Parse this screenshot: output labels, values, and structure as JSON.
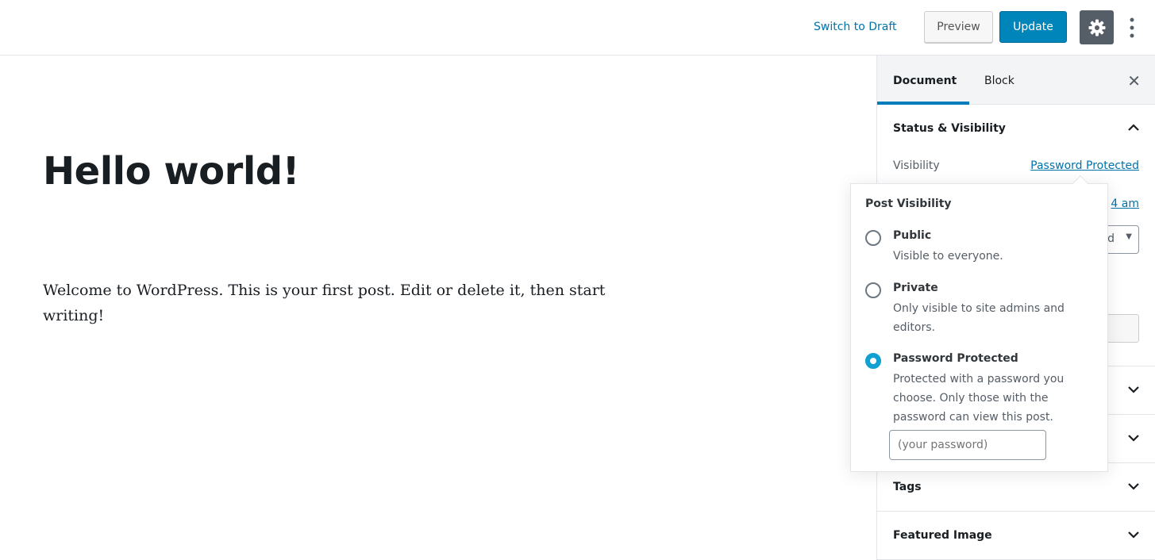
{
  "topbar": {
    "switch_to_draft": "Switch to Draft",
    "preview": "Preview",
    "update": "Update",
    "settings_icon": "gear-icon",
    "more_icon": "vertical-ellipsis-icon"
  },
  "editor": {
    "title": "Hello world!",
    "paragraph": "Welcome to WordPress. This is your first post. Edit or delete it, then start writing!"
  },
  "sidebar": {
    "tabs": [
      {
        "label": "Document",
        "active": true
      },
      {
        "label": "Block",
        "active": false
      }
    ],
    "status_visibility": {
      "title": "Status & Visibility",
      "visibility_label": "Visibility",
      "visibility_value": "Password Protected",
      "publish_fragment": "4 am",
      "select_fragment": "d"
    },
    "panels": [
      {
        "title": ""
      },
      {
        "title": ""
      },
      {
        "title": "Tags"
      },
      {
        "title": "Featured Image"
      }
    ]
  },
  "popover": {
    "title": "Post Visibility",
    "options": [
      {
        "label": "Public",
        "desc": "Visible to everyone.",
        "selected": false
      },
      {
        "label": "Private",
        "desc": "Only visible to site admins and editors.",
        "selected": false
      },
      {
        "label": "Password Protected",
        "desc": "Protected with a password you choose. Only those with the password can view this post.",
        "selected": true
      }
    ],
    "password_placeholder": "(your password)"
  },
  "colors": {
    "accent": "#0085ba",
    "radio_selected": "#11a0d2",
    "link": "#0073aa"
  }
}
